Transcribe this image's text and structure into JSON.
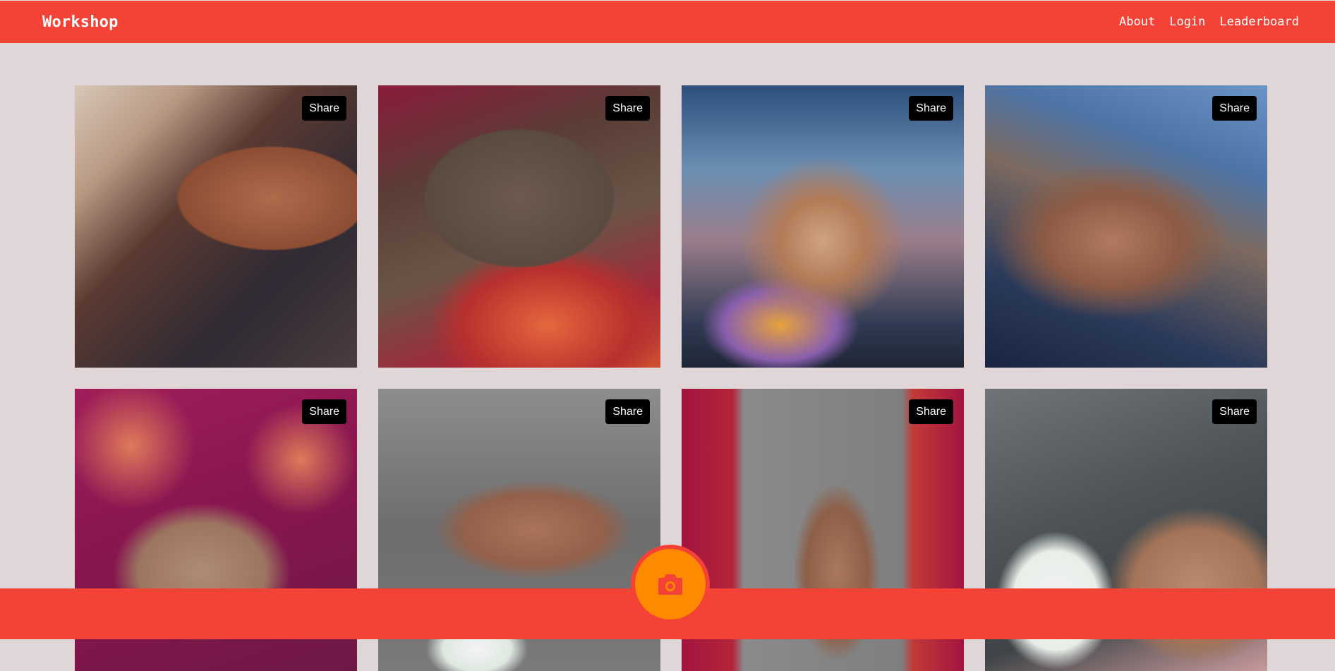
{
  "header": {
    "brand": "Workshop",
    "nav": [
      {
        "label": "About"
      },
      {
        "label": "Login"
      },
      {
        "label": "Leaderboard"
      }
    ]
  },
  "gallery": {
    "cards": [
      {
        "share_label": "Share"
      },
      {
        "share_label": "Share"
      },
      {
        "share_label": "Share"
      },
      {
        "share_label": "Share"
      },
      {
        "share_label": "Share"
      },
      {
        "share_label": "Share"
      },
      {
        "share_label": "Share"
      },
      {
        "share_label": "Share"
      }
    ]
  },
  "camera": {
    "icon": "camera-icon"
  },
  "colors": {
    "bar": "#f44336",
    "background": "#e0d5d7",
    "camera": "#ff8a00",
    "share_button": "#000000"
  }
}
